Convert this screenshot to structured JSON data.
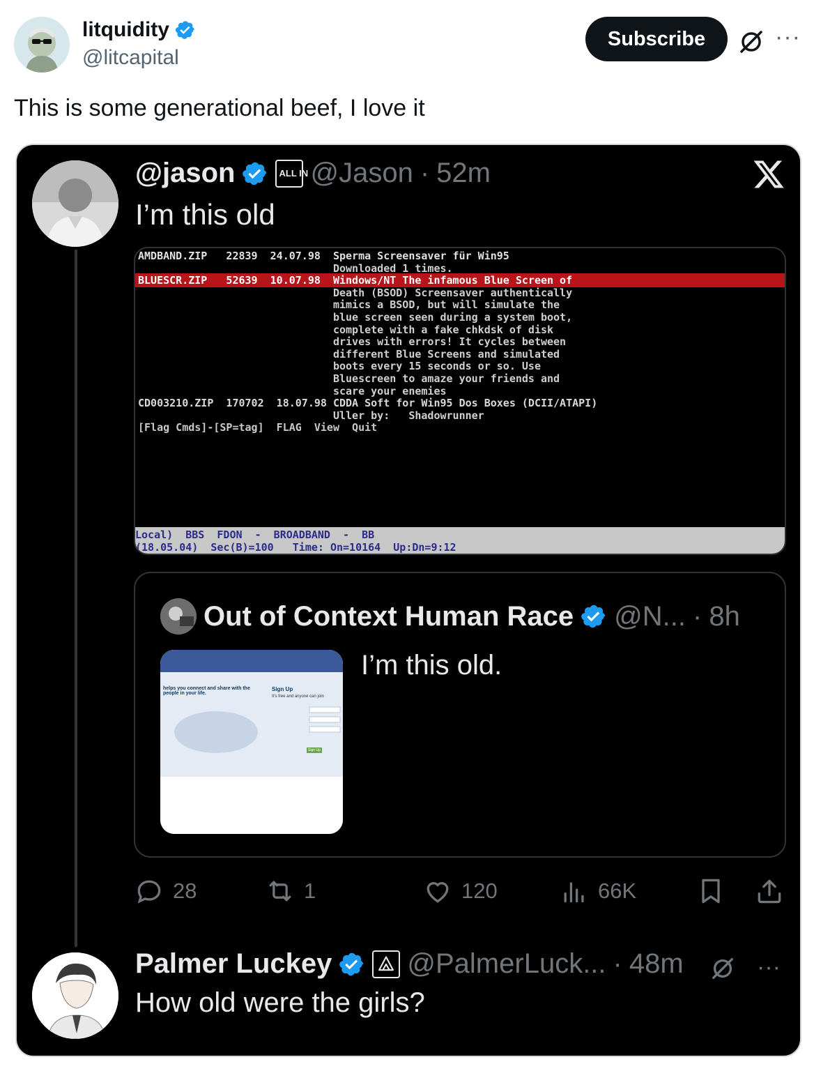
{
  "author": {
    "display_name": "litquidity",
    "handle": "@litcapital",
    "verified": true
  },
  "subscribe_label": "Subscribe",
  "tweet_text": "This is some generational beef, I love it",
  "embedded": {
    "jason": {
      "display_name": "@jason",
      "affiliation_badge": "ALL IN",
      "handle": "@Jason",
      "separator": "·",
      "time": "52m",
      "text": "I’m this old"
    },
    "terminal_screenshot": {
      "lines": [
        "AMDBAND.ZIP   22839  24.07.98  Sperma Screensaver für Win95",
        "                               Downloaded 1 times.",
        "BLUESCR.ZIP   52639  10.07.98  Windows/NT The infamous Blue Screen of",
        "                               Death (BSOD) Screensaver authentically",
        "                               mimics a BSOD, but will simulate the",
        "                               blue screen seen during a system boot,",
        "                               complete with a fake chkdsk of disk",
        "                               drives with errors! It cycles between",
        "                               different Blue Screens and simulated",
        "                               boots every 15 seconds or so. Use",
        "                               Bluescreen to amaze your friends and",
        "                               scare your enemies",
        "CD003210.ZIP  170702  18.07.98 CDDA Soft for Win95 Dos Boxes (DCII/ATAPI)",
        "                               Uller by:   Shadowrunner",
        "[Flag Cmds]-[SP=tag]  FLAG  View  Quit"
      ],
      "status_line_1": "Local)  BBS  FDON  -  BROADBAND  -  BB",
      "status_line_2": "(18.05.04)  Sec(B)=100   Time: On=10164  Up:Dn=9:12"
    },
    "quote": {
      "display_name": "Out of Context Human Race",
      "handle": "@N...",
      "separator": "·",
      "time": "8h",
      "text": "I’m this old.",
      "thumbnail": {
        "tagline": "helps you connect and share with the people in your life.",
        "signup_title": "Sign Up",
        "signup_sub": "It's free and anyone can join",
        "button": "Sign Up"
      }
    },
    "actions": {
      "replies": "28",
      "reposts": "1",
      "likes": "120",
      "views": "66K"
    },
    "palmer": {
      "display_name": "Palmer Luckey",
      "handle": "@PalmerLuck...",
      "separator": "·",
      "time": "48m",
      "text": "How old were the girls?"
    }
  },
  "colors": {
    "verified_blue": "#1d9bf0",
    "card_bg": "#000000",
    "muted": "#71767b",
    "terminal_red": "#b8141a"
  }
}
